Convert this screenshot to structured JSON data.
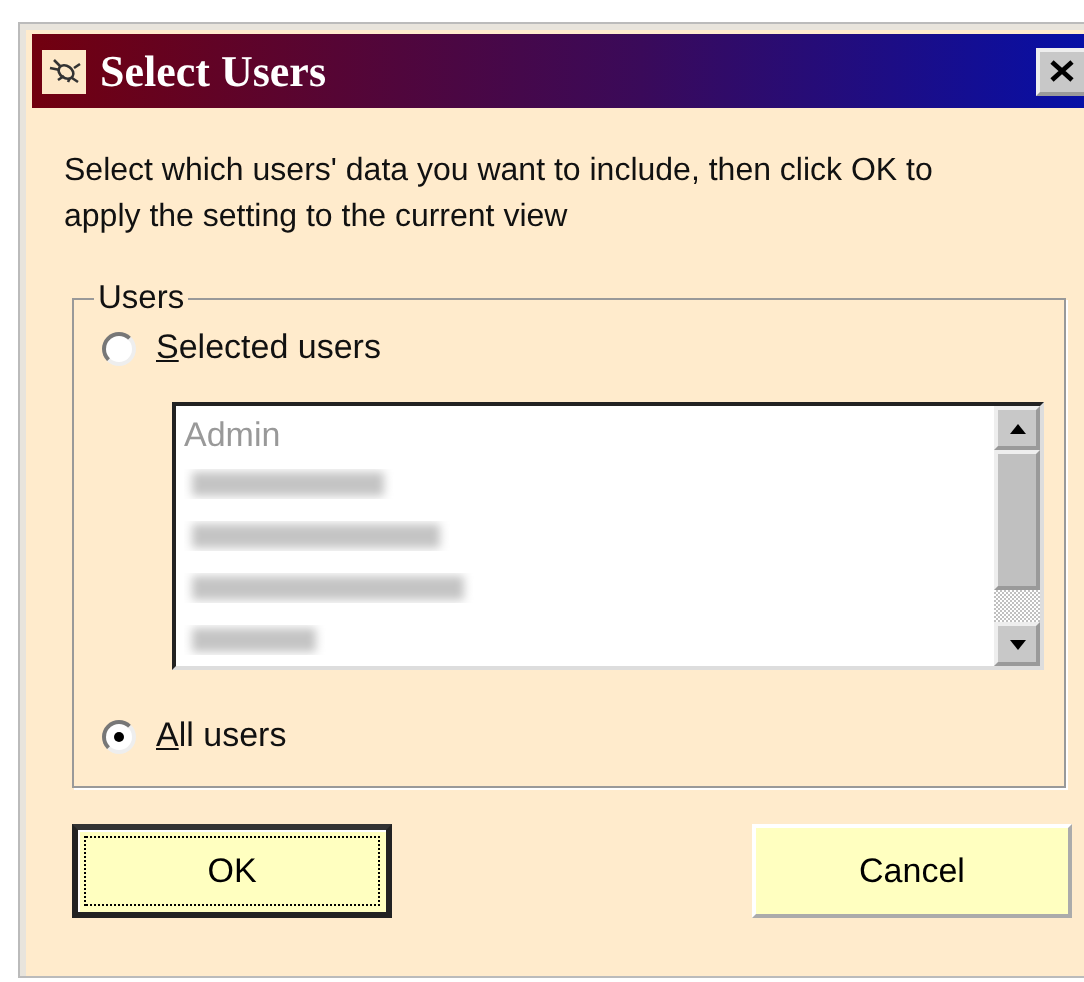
{
  "window": {
    "title": "Select Users"
  },
  "instructions": "Select which users' data you want to include, then click OK to apply the setting to the current view",
  "group": {
    "label": "Users",
    "options": [
      {
        "label": "Selected users",
        "selected": false,
        "kind": "list"
      },
      {
        "label": "All users",
        "selected": true,
        "kind": "plain"
      }
    ],
    "list": {
      "disabled": true,
      "items": [
        {
          "kind": "text",
          "text": "Admin"
        },
        {
          "kind": "redacted"
        },
        {
          "kind": "redacted"
        },
        {
          "kind": "redacted"
        },
        {
          "kind": "redacted"
        }
      ]
    }
  },
  "buttons": [
    {
      "label": "OK",
      "default": true
    },
    {
      "label": "Cancel",
      "default": false
    }
  ]
}
